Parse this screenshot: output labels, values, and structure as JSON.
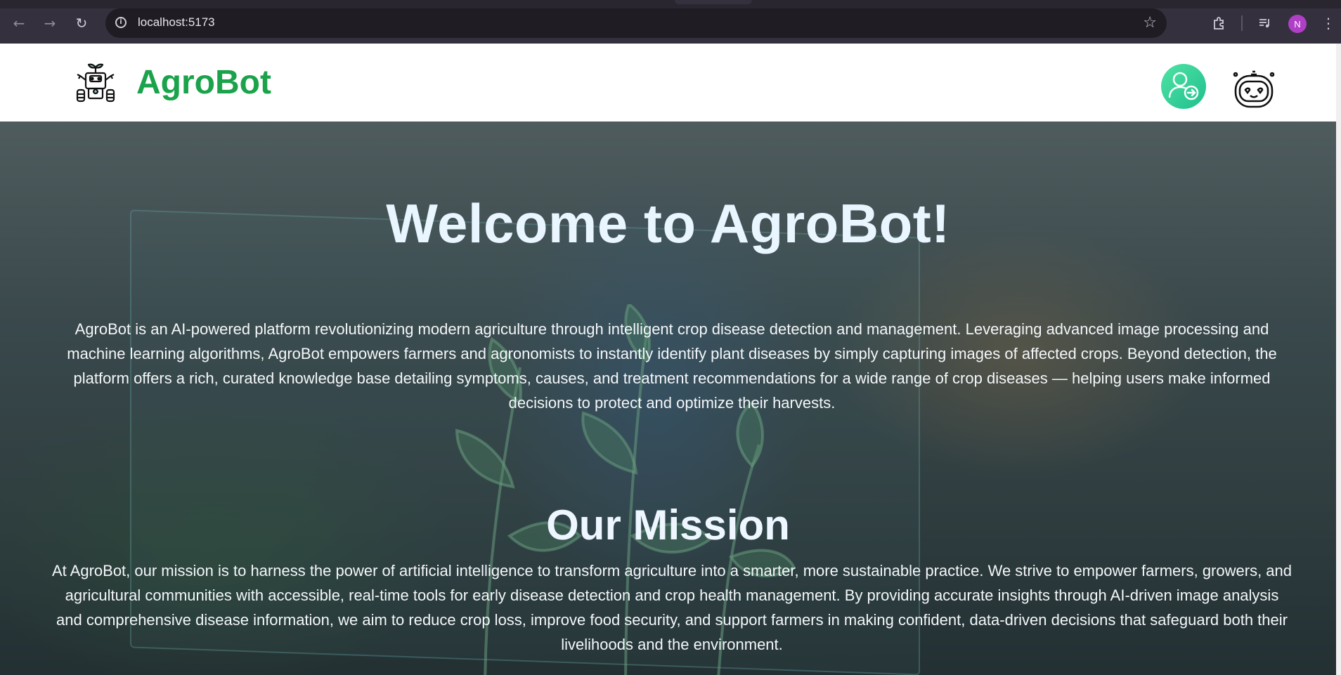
{
  "browser": {
    "url": "localhost:5173",
    "profile_initial": "N"
  },
  "header": {
    "brand": "AgroBot",
    "logo_icon": "robot-farmer-icon",
    "login_icon": "user-login-icon",
    "chatbot_icon": "robot-face-icon"
  },
  "hero": {
    "title": "Welcome to AgroBot!",
    "intro": "AgroBot is an AI-powered platform revolutionizing modern agriculture through intelligent crop disease detection and management. Leveraging advanced image processing and machine learning algorithms, AgroBot empowers farmers and agronomists to instantly identify plant diseases by simply capturing images of affected crops. Beyond detection, the platform offers a rich, curated knowledge base detailing symptoms, causes, and treatment recommendations for a wide range of crop diseases — helping users make informed decisions to protect and optimize their harvests.",
    "mission_title": "Our Mission",
    "mission": "At AgroBot, our mission is to harness the power of artificial intelligence to transform agriculture into a smarter, more sustainable practice. We strive to empower farmers, growers, and agricultural communities with accessible, real-time tools for early disease detection and crop health management. By providing accurate insights through AI-driven image analysis and comprehensive disease information, we aim to reduce crop loss, improve food security, and support farmers in making confident, data-driven decisions that safeguard both their livelihoods and the environment."
  },
  "colors": {
    "brand_green": "#1aa34a",
    "login_gradient_start": "#50e3a4",
    "login_gradient_end": "#1fbf8f"
  }
}
